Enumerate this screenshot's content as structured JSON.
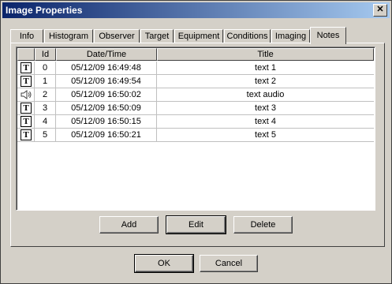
{
  "window": {
    "title": "Image Properties",
    "close_label": "✕"
  },
  "tabs": [
    {
      "label": "Info"
    },
    {
      "label": "Histogram"
    },
    {
      "label": "Observer"
    },
    {
      "label": "Target"
    },
    {
      "label": "Equipment"
    },
    {
      "label": "Conditions"
    },
    {
      "label": "Imaging"
    },
    {
      "label": "Notes",
      "active": true
    }
  ],
  "notes": {
    "columns": [
      "",
      "Id",
      "Date/Time",
      "Title"
    ],
    "rows": [
      {
        "type": "text",
        "id": "0",
        "datetime": "05/12/09 16:49:48",
        "title": "text 1"
      },
      {
        "type": "text",
        "id": "1",
        "datetime": "05/12/09 16:49:54",
        "title": "text 2"
      },
      {
        "type": "audio",
        "id": "2",
        "datetime": "05/12/09 16:50:02",
        "title": "text audio"
      },
      {
        "type": "text",
        "id": "3",
        "datetime": "05/12/09 16:50:09",
        "title": "text 3"
      },
      {
        "type": "text",
        "id": "4",
        "datetime": "05/12/09 16:50:15",
        "title": "text 4"
      },
      {
        "type": "text",
        "id": "5",
        "datetime": "05/12/09 16:50:21",
        "title": "text 5"
      }
    ],
    "text_icon_glyph": "T"
  },
  "buttons": {
    "add": "Add",
    "edit": "Edit",
    "delete": "Delete",
    "ok": "OK",
    "cancel": "Cancel"
  }
}
